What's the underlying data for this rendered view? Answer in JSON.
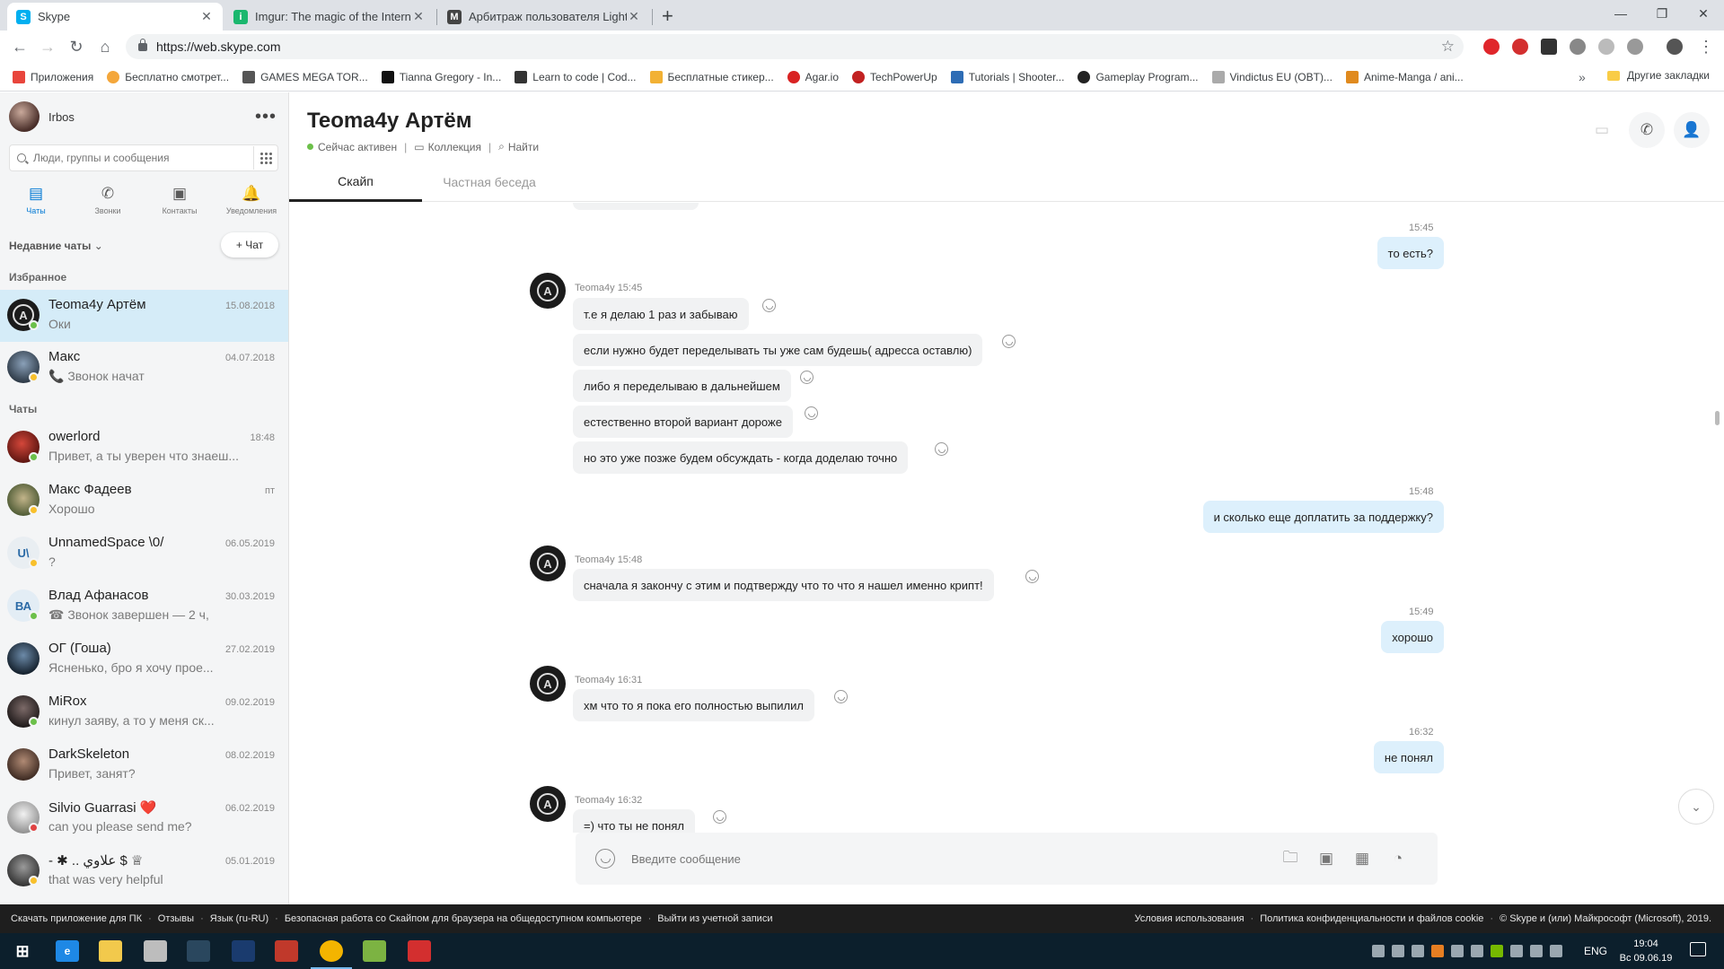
{
  "browser": {
    "tabs": [
      {
        "title": "Skype",
        "color": "#00aff0",
        "glyph": "S"
      },
      {
        "title": "Imgur: The magic of the Internet",
        "color": "#1bb76e",
        "glyph": "i"
      },
      {
        "title": "Арбитраж пользователя LightF",
        "color": "#444444",
        "glyph": "M"
      }
    ],
    "url": "https://web.skype.com",
    "bookmarks": [
      {
        "label": "Приложения",
        "color": "#e8453c"
      },
      {
        "label": "Бесплатно смотрет...",
        "color": "#f4a73b"
      },
      {
        "label": "GAMES MEGA TOR...",
        "color": "#555555"
      },
      {
        "label": "Tianna Gregory - In...",
        "color": "#111111"
      },
      {
        "label": "Learn to code | Cod...",
        "color": "#333333"
      },
      {
        "label": "Бесплатные стикер...",
        "color": "#f2b134"
      },
      {
        "label": "Agar.io",
        "color": "#d92323"
      },
      {
        "label": "TechPowerUp",
        "color": "#c22121"
      },
      {
        "label": "Tutorials | Shooter...",
        "color": "#2d6cb5"
      },
      {
        "label": "Gameplay Program...",
        "color": "#222222"
      },
      {
        "label": "Vindictus EU (OBT)...",
        "color": "#aaaaaa"
      },
      {
        "label": "Anime-Manga / ani...",
        "color": "#e08a1e"
      }
    ],
    "other_bookmarks": "Другие закладки"
  },
  "sidebar": {
    "user": "Irbos",
    "search_placeholder": "Люди, группы и сообщения",
    "nav": [
      {
        "label": "Чаты",
        "icon": "chat-icon"
      },
      {
        "label": "Звонки",
        "icon": "phone-icon"
      },
      {
        "label": "Контакты",
        "icon": "contacts-icon"
      },
      {
        "label": "Уведомления",
        "icon": "bell-icon"
      }
    ],
    "recent_label": "Недавние чаты",
    "new_chat": "+ Чат",
    "favorites_label": "Избранное",
    "chats_label": "Чаты",
    "favorites": [
      {
        "name": "Teoma4y Артём",
        "preview": "Оки",
        "date": "15.08.2018",
        "status": "#6cc04a"
      },
      {
        "name": "Макс",
        "preview": "📞 Звонок начат",
        "date": "04.07.2018",
        "status": "#f8c02c"
      }
    ],
    "chats": [
      {
        "name": "owerlord",
        "preview": "Привет, а ты уверен что знаеш...",
        "date": "18:48",
        "status": "#6cc04a"
      },
      {
        "name": "Макс Фадеев",
        "preview": "Хорошо",
        "date": "пт",
        "status": "#f8c02c"
      },
      {
        "name": "UnnamedSpace \\0/",
        "preview": "?",
        "date": "06.05.2019",
        "status": "#f8c02c",
        "initials": "U\\"
      },
      {
        "name": "Влад Афанасов",
        "preview": "☎ Звонок завершен — 2 ч,",
        "date": "30.03.2019",
        "status": "#6cc04a",
        "initials": "ВА"
      },
      {
        "name": "ОГ (Гоша)",
        "preview": "Ясненько, бро я хочу прое...",
        "date": "27.02.2019",
        "status": ""
      },
      {
        "name": "MiRox",
        "preview": "кинул заяву, а то у меня ск...",
        "date": "09.02.2019",
        "status": "#6cc04a"
      },
      {
        "name": "DarkSkeleton",
        "preview": "Привет, занят?",
        "date": "08.02.2019",
        "status": ""
      },
      {
        "name": "Silvio Guarrasi ❤️",
        "preview": "can you please send me?",
        "date": "06.02.2019",
        "status": "#e04343"
      },
      {
        "name": "- ✱ .. علاوي $ ♕",
        "preview": "that was very helpful",
        "date": "05.01.2019",
        "status": "#f8c02c"
      }
    ]
  },
  "conversation": {
    "title": "Teoma4y Артём",
    "status": "Сейчас активен",
    "gallery": "Коллекция",
    "find": "Найти",
    "tabs": [
      "Скайп",
      "Частная беседа"
    ],
    "messages": [
      {
        "dir": "out",
        "time": "15:45",
        "text": "то есть?"
      },
      {
        "dir": "in",
        "sender": "Teoma4y 15:45",
        "texts": [
          "т.е я делаю 1 раз и забываю",
          "если нужно будет переделывать ты уже сам будешь( адресса оставлю)",
          "либо я переделываю в дальнейшем",
          "естественно второй вариант дороже",
          "но это уже позже будем обсуждать - когда доделаю точно"
        ]
      },
      {
        "dir": "out",
        "time": "15:48",
        "text": "и сколько еще доплатить за поддержку?"
      },
      {
        "dir": "in",
        "sender": "Teoma4y 15:48",
        "texts": [
          "сначала я закончу с этим и подтвержду что то что я нашел именно крипт!"
        ]
      },
      {
        "dir": "out",
        "time": "15:49",
        "text": "хорошо"
      },
      {
        "dir": "in",
        "sender": "Teoma4y 16:31",
        "texts": [
          "хм что то я пока его полностью выпилил"
        ]
      },
      {
        "dir": "out",
        "time": "16:32",
        "text": "не понял"
      },
      {
        "dir": "in",
        "sender": "Teoma4y 16:32",
        "texts": [
          "=) что ты  не понял"
        ]
      }
    ],
    "composer_placeholder": "Введите сообщение"
  },
  "footer": {
    "left": [
      "Скачать приложение для ПК",
      "Отзывы",
      "Язык (ru-RU)",
      "Безопасная работа со Скайпом для браузера на общедоступном компьютере",
      "Выйти из учетной записи"
    ],
    "right": [
      "Условия использования",
      "Политика конфиденциальности и файлов cookie",
      "© Skype и (или) Майкрософт (Microsoft), 2019."
    ]
  },
  "taskbar": {
    "lang": "ENG",
    "time": "19:04",
    "date": "Вс 09.06.19"
  }
}
